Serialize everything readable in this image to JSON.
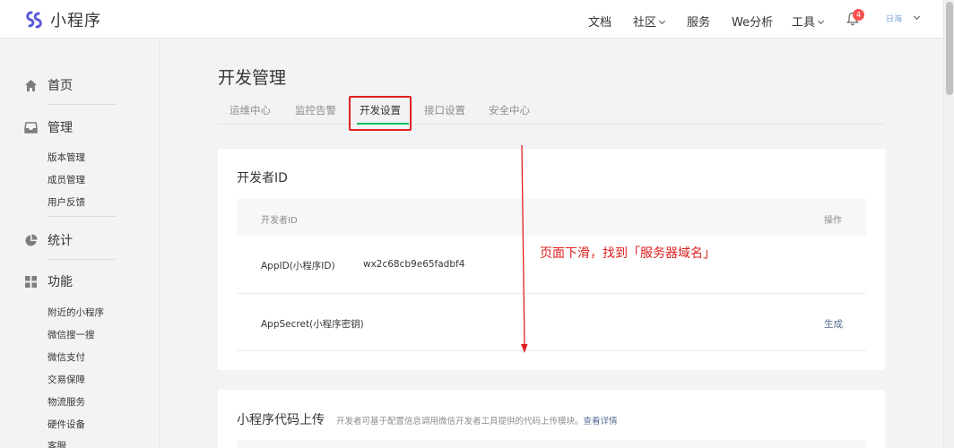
{
  "header": {
    "app_name": "小程序",
    "nav": [
      "文档",
      "社区",
      "服务",
      "We分析",
      "工具"
    ],
    "notification_count": "4",
    "user_name": "日海"
  },
  "sidebar": {
    "sections": [
      {
        "label": "首页",
        "icon": "home-icon",
        "items": []
      },
      {
        "label": "管理",
        "icon": "inbox-icon",
        "items": [
          "版本管理",
          "成员管理",
          "用户反馈"
        ]
      },
      {
        "label": "统计",
        "icon": "pie-chart-icon",
        "items": []
      },
      {
        "label": "功能",
        "icon": "grid-icon",
        "items": [
          "附近的小程序",
          "微信搜一搜",
          "微信支付",
          "交易保障",
          "物流服务",
          "硬件设备",
          "客服"
        ]
      }
    ]
  },
  "main": {
    "title": "开发管理",
    "tabs": [
      "运维中心",
      "监控告警",
      "开发设置",
      "接口设置",
      "安全中心"
    ],
    "active_tab": "开发设置",
    "developer_card": {
      "title": "开发者ID",
      "col_id": "开发者ID",
      "col_action": "操作",
      "rows": [
        {
          "label": "AppID(小程序ID)",
          "value": "wx2c68cb9e65fadbf4",
          "action": ""
        },
        {
          "label": "AppSecret(小程序密钥)",
          "value": "",
          "action": "生成"
        }
      ]
    },
    "upload_card": {
      "title": "小程序代码上传",
      "desc": "开发者可基于配置信息调用微信开发者工具提供的代码上传模块。",
      "link": "查看详情"
    }
  },
  "annotation": {
    "text": "页面下滑，找到「服务器域名」",
    "color": "#e02020"
  },
  "colors": {
    "accent": "#07c160",
    "link": "#576b95",
    "highlight": "#e02020",
    "badge": "#fa5151"
  }
}
